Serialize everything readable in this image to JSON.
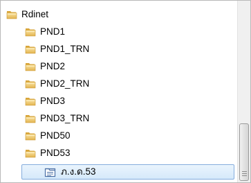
{
  "tree": {
    "root": {
      "label": "Rdinet",
      "icon": "folder-icon"
    },
    "folders": [
      {
        "label": "PND1",
        "icon": "folder-icon"
      },
      {
        "label": "PND1_TRN",
        "icon": "folder-icon"
      },
      {
        "label": "PND2",
        "icon": "folder-icon"
      },
      {
        "label": "PND2_TRN",
        "icon": "folder-icon"
      },
      {
        "label": "PND3",
        "icon": "folder-icon"
      },
      {
        "label": "PND3_TRN",
        "icon": "folder-icon"
      },
      {
        "label": "PND50",
        "icon": "folder-icon"
      },
      {
        "label": "PND53",
        "icon": "folder-icon"
      }
    ],
    "selected_item": {
      "label": "ภ.ง.ด.53",
      "icon": "document-icon"
    }
  },
  "colors": {
    "folder": "#e9c66a",
    "selection_bg": "#d5e9fa",
    "selection_border": "#84acdd"
  }
}
